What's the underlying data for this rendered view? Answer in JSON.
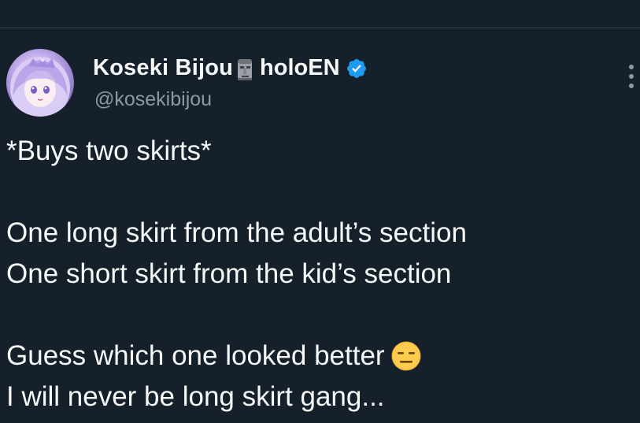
{
  "header": {
    "display_name": "Koseki Bijou",
    "display_name_suffix": "holoEN",
    "handle": "@kosekibijou",
    "icons": [
      "moai-icon",
      "verified-icon",
      "more-icon",
      "avatar"
    ]
  },
  "tweet": {
    "lines": [
      "*Buys two skirts*",
      "One long skirt from the adult’s section",
      "One short skirt from the kid’s section",
      "Guess which one looked better",
      "I will never be long skirt gang..."
    ],
    "emoji": "expressionless-face-icon"
  },
  "colors": {
    "background": "#15202b",
    "text": "#f7f9f9",
    "secondary": "#8b98a5",
    "verified": "#1d9bf0",
    "divider": "#38444d"
  }
}
